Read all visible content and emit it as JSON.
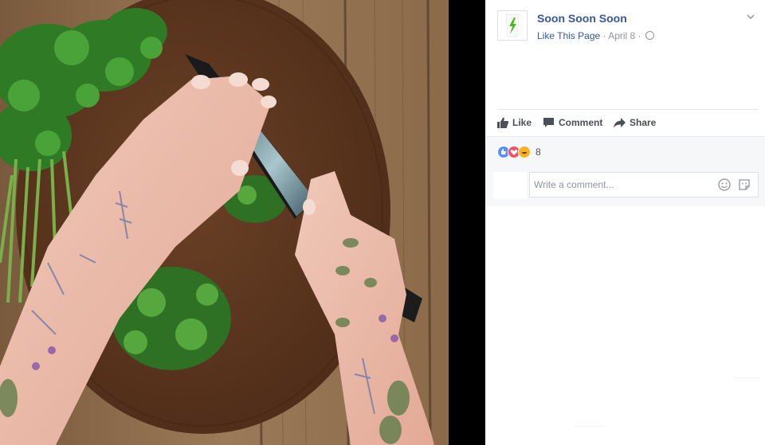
{
  "post": {
    "page_name": "Soon Soon Soon",
    "like_page": "Like This Page",
    "separator": "·",
    "date": "April 8",
    "date_separator": "·"
  },
  "actions": {
    "like": "Like",
    "comment": "Comment",
    "share": "Share"
  },
  "reactions": {
    "icons": [
      "like-reaction",
      "love-reaction",
      "haha-reaction"
    ],
    "count": "8"
  },
  "comment": {
    "placeholder": "Write a comment..."
  },
  "colors": {
    "link": "#365899",
    "meta": "#90949c",
    "brand_icon": "#4cbb17",
    "panel_bg": "#f6f7f9"
  }
}
